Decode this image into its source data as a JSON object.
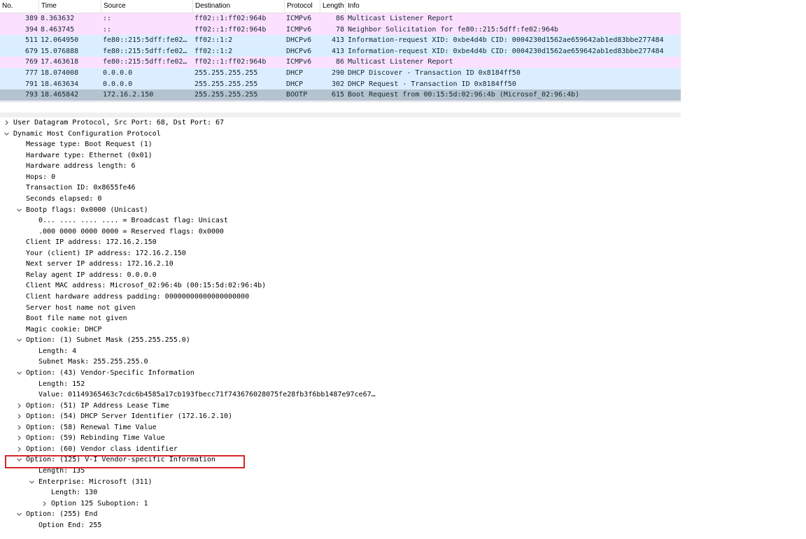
{
  "packet_list": {
    "columns": [
      "No.",
      "Time",
      "Source",
      "Destination",
      "Protocol",
      "Length",
      "Info"
    ],
    "rows": [
      {
        "no": "389",
        "time": "8.363632",
        "src": "::",
        "dst": "ff02::1:ff02:964b",
        "proto": "ICMPv6",
        "len": "86",
        "info": "Multicast Listener Report",
        "bg": "#fce0ff"
      },
      {
        "no": "394",
        "time": "8.463745",
        "src": "::",
        "dst": "ff02::1:ff02:964b",
        "proto": "ICMPv6",
        "len": "78",
        "info": "Neighbor Solicitation for fe80::215:5dff:fe02:964b",
        "bg": "#fce0ff"
      },
      {
        "no": "511",
        "time": "12.064950",
        "src": "fe80::215:5dff:fe02…",
        "dst": "ff02::1:2",
        "proto": "DHCPv6",
        "len": "413",
        "info": "Information-request XID: 0xbe4d4b CID: 0004230d1562ae659642ab1ed83bbe277484",
        "bg": "#daeeff"
      },
      {
        "no": "679",
        "time": "15.076888",
        "src": "fe80::215:5dff:fe02…",
        "dst": "ff02::1:2",
        "proto": "DHCPv6",
        "len": "413",
        "info": "Information-request XID: 0xbe4d4b CID: 0004230d1562ae659642ab1ed83bbe277484",
        "bg": "#daeeff"
      },
      {
        "no": "769",
        "time": "17.463618",
        "src": "fe80::215:5dff:fe02…",
        "dst": "ff02::1:ff02:964b",
        "proto": "ICMPv6",
        "len": "86",
        "info": "Multicast Listener Report",
        "bg": "#fce0ff"
      },
      {
        "no": "777",
        "time": "18.074008",
        "src": "0.0.0.0",
        "dst": "255.255.255.255",
        "proto": "DHCP",
        "len": "290",
        "info": "DHCP Discover - Transaction ID 0x8184ff50",
        "bg": "#daeeff"
      },
      {
        "no": "791",
        "time": "18.463634",
        "src": "0.0.0.0",
        "dst": "255.255.255.255",
        "proto": "DHCP",
        "len": "302",
        "info": "DHCP Request  - Transaction ID 0x8184ff50",
        "bg": "#daeeff"
      },
      {
        "no": "793",
        "time": "18.465842",
        "src": "172.16.2.150",
        "dst": "255.255.255.255",
        "proto": "BOOTP",
        "len": "615",
        "info": "Boot Request from 00:15:5d:02:96:4b (Microsof_02:96:4b)",
        "bg": "#b3c3d0"
      }
    ]
  },
  "colors": {
    "arrow": "#6e6e6e",
    "highlight": "#d6252a"
  },
  "details": [
    {
      "text": "User Datagram Protocol, Src Port: 68, Dst Port: 67",
      "indent": 0,
      "arrow": "collapsed"
    },
    {
      "text": "Dynamic Host Configuration Protocol",
      "indent": 0,
      "arrow": "expanded"
    },
    {
      "text": "Message type: Boot Request (1)",
      "indent": 1,
      "arrow": "none"
    },
    {
      "text": "Hardware type: Ethernet (0x01)",
      "indent": 1,
      "arrow": "none"
    },
    {
      "text": "Hardware address length: 6",
      "indent": 1,
      "arrow": "none"
    },
    {
      "text": "Hops: 0",
      "indent": 1,
      "arrow": "none"
    },
    {
      "text": "Transaction ID: 0x8655fe46",
      "indent": 1,
      "arrow": "none"
    },
    {
      "text": "Seconds elapsed: 0",
      "indent": 1,
      "arrow": "none"
    },
    {
      "text": "Bootp flags: 0x0000 (Unicast)",
      "indent": 1,
      "arrow": "expanded"
    },
    {
      "text": "0... .... .... .... = Broadcast flag: Unicast",
      "indent": 2,
      "arrow": "none"
    },
    {
      "text": ".000 0000 0000 0000 = Reserved flags: 0x0000",
      "indent": 2,
      "arrow": "none"
    },
    {
      "text": "Client IP address: 172.16.2.150",
      "indent": 1,
      "arrow": "none"
    },
    {
      "text": "Your (client) IP address: 172.16.2.150",
      "indent": 1,
      "arrow": "none"
    },
    {
      "text": "Next server IP address: 172.16.2.10",
      "indent": 1,
      "arrow": "none"
    },
    {
      "text": "Relay agent IP address: 0.0.0.0",
      "indent": 1,
      "arrow": "none"
    },
    {
      "text": "Client MAC address: Microsof_02:96:4b (00:15:5d:02:96:4b)",
      "indent": 1,
      "arrow": "none"
    },
    {
      "text": "Client hardware address padding: 00000000000000000000",
      "indent": 1,
      "arrow": "none"
    },
    {
      "text": "Server host name not given",
      "indent": 1,
      "arrow": "none"
    },
    {
      "text": "Boot file name not given",
      "indent": 1,
      "arrow": "none"
    },
    {
      "text": "Magic cookie: DHCP",
      "indent": 1,
      "arrow": "none"
    },
    {
      "text": "Option: (1) Subnet Mask (255.255.255.0)",
      "indent": 1,
      "arrow": "expanded"
    },
    {
      "text": "Length: 4",
      "indent": 2,
      "arrow": "none"
    },
    {
      "text": "Subnet Mask: 255.255.255.0",
      "indent": 2,
      "arrow": "none"
    },
    {
      "text": "Option: (43) Vendor-Specific Information",
      "indent": 1,
      "arrow": "expanded"
    },
    {
      "text": "Length: 152",
      "indent": 2,
      "arrow": "none"
    },
    {
      "text": "Value: 01149365463c7cdc6b4585a17cb193fbecc71f743676028075fe28fb3f6bb1487e97ce67…",
      "indent": 2,
      "arrow": "none"
    },
    {
      "text": "Option: (51) IP Address Lease Time",
      "indent": 1,
      "arrow": "collapsed"
    },
    {
      "text": "Option: (54) DHCP Server Identifier (172.16.2.10)",
      "indent": 1,
      "arrow": "collapsed"
    },
    {
      "text": "Option: (58) Renewal Time Value",
      "indent": 1,
      "arrow": "collapsed"
    },
    {
      "text": "Option: (59) Rebinding Time Value",
      "indent": 1,
      "arrow": "collapsed"
    },
    {
      "text": "Option: (60) Vendor class identifier",
      "indent": 1,
      "arrow": "collapsed"
    },
    {
      "text": "Option: (125) V-I Vendor-specific Information",
      "indent": 1,
      "arrow": "expanded"
    },
    {
      "text": "Length: 135",
      "indent": 2,
      "arrow": "none"
    },
    {
      "text": "Enterprise: Microsoft (311)",
      "indent": 2,
      "arrow": "expanded"
    },
    {
      "text": "Length: 130",
      "indent": 3,
      "arrow": "none"
    },
    {
      "text": "Option 125 Suboption: 1",
      "indent": 3,
      "arrow": "collapsed"
    },
    {
      "text": "Option: (255) End",
      "indent": 1,
      "arrow": "expanded"
    },
    {
      "text": "Option End: 255",
      "indent": 2,
      "arrow": "none"
    }
  ]
}
